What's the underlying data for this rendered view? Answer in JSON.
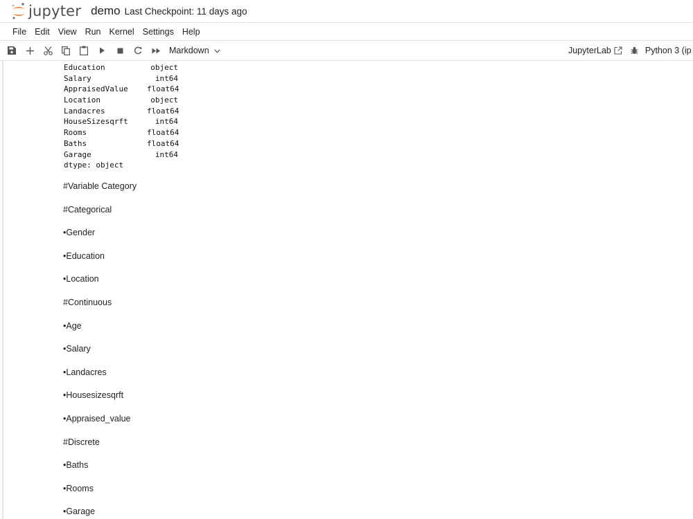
{
  "header": {
    "logo_text": "jupyter",
    "notebook_name": "demo",
    "checkpoint": "Last Checkpoint: 11 days ago"
  },
  "menu": [
    "File",
    "Edit",
    "View",
    "Run",
    "Kernel",
    "Settings",
    "Help"
  ],
  "toolbar": {
    "icons": [
      "save-icon",
      "add-cell-icon",
      "cut-icon",
      "copy-icon",
      "paste-icon",
      "run-icon",
      "stop-icon",
      "restart-icon",
      "fast-forward-icon"
    ],
    "cell_type": "Markdown",
    "jupyterlab_label": "JupyterLab",
    "kernel_label": "Python 3 (ip"
  },
  "output": {
    "rows": [
      {
        "col": "Education",
        "dtype": "object"
      },
      {
        "col": "Salary",
        "dtype": "int64"
      },
      {
        "col": "AppraisedValue",
        "dtype": "float64"
      },
      {
        "col": "Location",
        "dtype": "object"
      },
      {
        "col": "Landacres",
        "dtype": "float64"
      },
      {
        "col": "HouseSizesqrft",
        "dtype": "int64"
      },
      {
        "col": "Rooms",
        "dtype": "float64"
      },
      {
        "col": "Baths",
        "dtype": "float64"
      },
      {
        "col": "Garage",
        "dtype": "int64"
      }
    ],
    "footer": "dtype: object"
  },
  "markdown_lines": [
    "#Variable Category",
    "#Categorical",
    "•Gender",
    "•Education",
    "•Location",
    "#Continuous",
    "•Age",
    "•Salary",
    "•Landacres",
    "•Housesizesqrft",
    "•Appraised_value",
    "#Discrete",
    "•Baths",
    "•Rooms",
    "•Garage"
  ]
}
